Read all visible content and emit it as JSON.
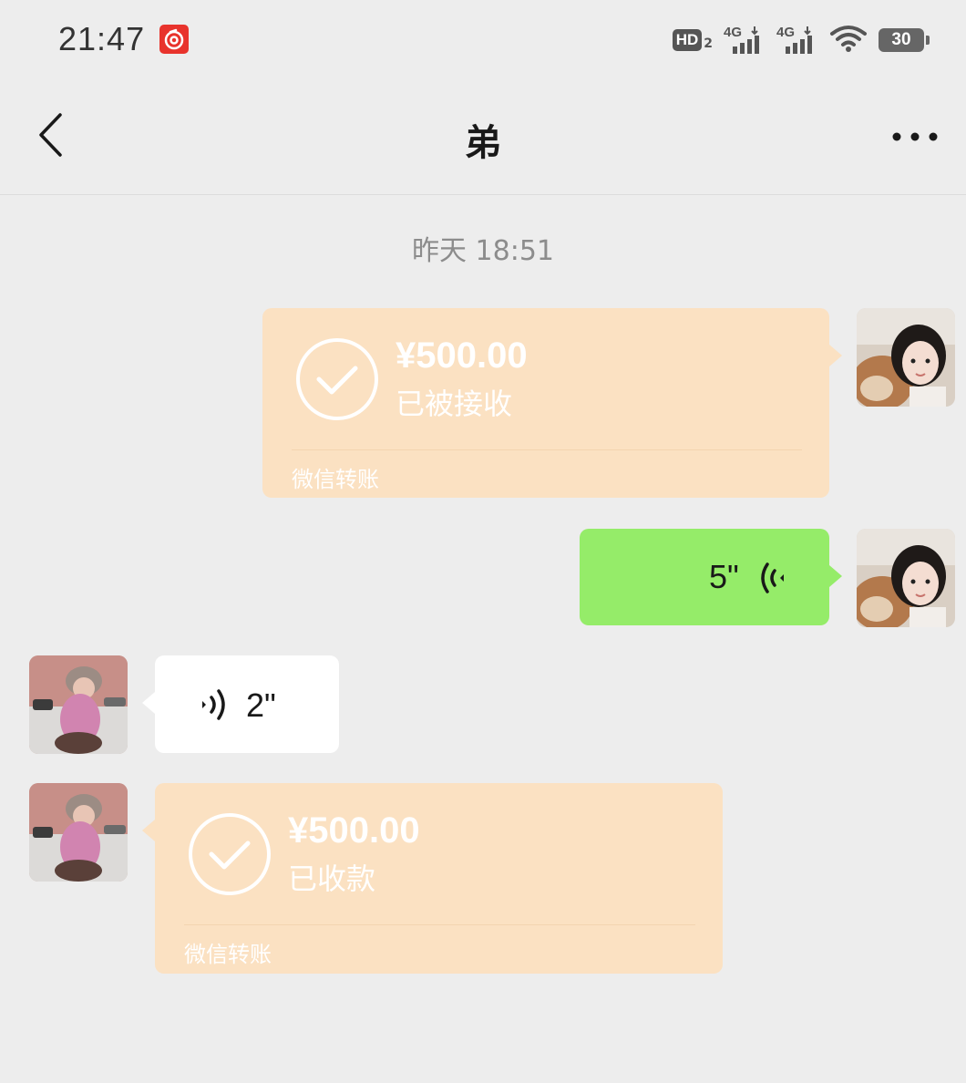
{
  "status_bar": {
    "time": "21:47",
    "hd_label": "HD",
    "hd_sub": "2",
    "net1": "4G",
    "net2": "4G",
    "battery": "30"
  },
  "header": {
    "title": "弟"
  },
  "chat": {
    "timestamp": "昨天 18:51",
    "messages": [
      {
        "type": "transfer",
        "side": "right",
        "amount": "¥500.00",
        "status": "已被接收",
        "footer": "微信转账"
      },
      {
        "type": "voice",
        "side": "right",
        "duration": "5\""
      },
      {
        "type": "voice",
        "side": "left",
        "duration": "2\""
      },
      {
        "type": "transfer",
        "side": "left",
        "amount": "¥500.00",
        "status": "已收款",
        "footer": "微信转账"
      }
    ]
  },
  "colors": {
    "background": "#ededed",
    "transfer_bubble": "#fbe1c2",
    "outgoing_bubble": "#95ec69",
    "incoming_bubble": "#ffffff",
    "badge_red": "#e8332c"
  },
  "icons": {
    "back": "chevron-left-icon",
    "more": "more-dots-icon",
    "check": "check-circle-icon",
    "voice": "voice-wave-icon"
  }
}
